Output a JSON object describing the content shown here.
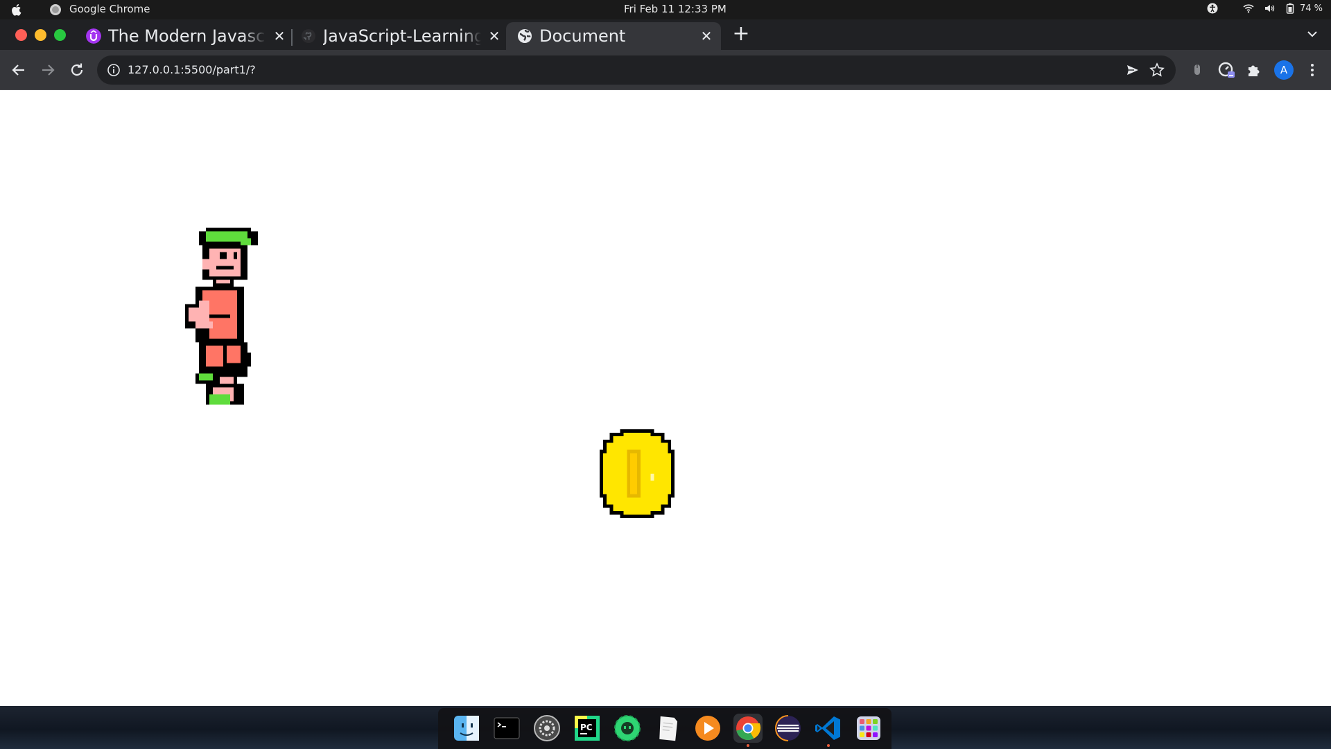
{
  "system_bar": {
    "app_name": "Google Chrome",
    "clock": "Fri Feb 11  12:33 PM",
    "battery": "74 %"
  },
  "tabs": [
    {
      "title": "The Modern Javascript Bootcamp",
      "favicon": "udemy-icon",
      "active": false
    },
    {
      "title": "JavaScript-Learning/Coin-Game",
      "favicon": "github-icon",
      "active": false
    },
    {
      "title": "Document",
      "favicon": "globe-icon",
      "active": true
    }
  ],
  "toolbar": {
    "url": "127.0.0.1:5500/part1/?",
    "avatar_letter": "A"
  },
  "dock": {
    "items": [
      "finder-icon",
      "terminal-icon",
      "settings-icon",
      "pycharm-icon",
      "gear-app-icon",
      "text-editor-icon",
      "media-player-icon",
      "chrome-icon",
      "eclipse-icon",
      "vscode-icon",
      "app-grid-icon"
    ],
    "pycharm_label": "PC"
  },
  "colors": {
    "chrome_dark": "#202124",
    "toolbar": "#35363a",
    "close_red": "#ff5f57",
    "minimize_yellow": "#febc2e",
    "zoom_green": "#28c840",
    "coin_yellow": "#ffe600",
    "hair_green": "#5fdc3c",
    "skin_pink": "#ffb3b3",
    "shirt_salmon": "#ff7565"
  }
}
